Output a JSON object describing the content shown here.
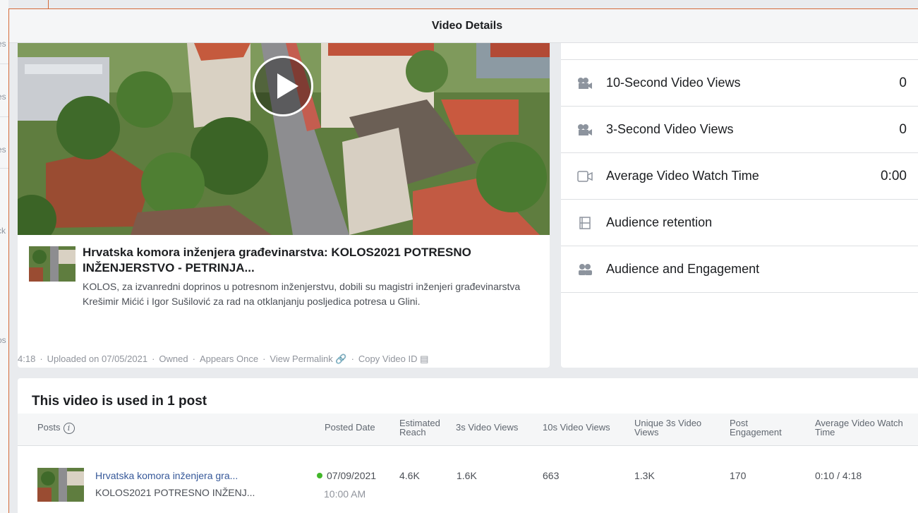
{
  "modal": {
    "title": "Video Details"
  },
  "background_fragments": [
    "es",
    "es",
    "es",
    "ck",
    "os"
  ],
  "video": {
    "title": "Hrvatska komora inženjera građevinarstva: KOLOS2021 POTRESNO INŽENJERSTVO - PETRINJA...",
    "description": "KOLOS, za izvanredni doprinos u potresnom inženjerstvu, dobili su magistri inženjeri građevinarstva Krešimir Mićić i Igor Sušilović za rad na otklanjanju posljedica potresa u Glini.",
    "duration": "4:18",
    "uploaded": "Uploaded on 07/05/2021",
    "ownership": "Owned",
    "appears": "Appears Once",
    "view_permalink": "View Permalink",
    "copy_id": "Copy Video ID"
  },
  "metrics": [
    {
      "label": "10-Second Video Views",
      "value": "0",
      "icon": "video-camera-icon"
    },
    {
      "label": "3-Second Video Views",
      "value": "0",
      "icon": "video-camera-icon"
    },
    {
      "label": "Average Video Watch Time",
      "value": "0:00",
      "icon": "video-outline-icon"
    },
    {
      "label": "Audience retention",
      "value": "",
      "icon": "film-icon"
    },
    {
      "label": "Audience and Engagement",
      "value": "",
      "icon": "people-icon"
    }
  ],
  "posts": {
    "heading": "This video is used in 1 post",
    "columns": {
      "posts": "Posts",
      "posted_date": "Posted Date",
      "reach_1": "Estimated",
      "reach_2": "Reach",
      "views3": "3s Video Views",
      "views10": "10s Video Views",
      "unique_1": "Unique 3s Video",
      "unique_2": "Views",
      "engagement_1": "Post",
      "engagement_2": "Engagement",
      "avg_1": "Average Video Watch",
      "avg_2": "Time"
    },
    "rows": [
      {
        "title": "Hrvatska komora inženjera gra...",
        "subtitle": "KOLOS2021 POTRESNO INŽENJ...",
        "date": "07/09/2021",
        "time": "10:00 AM",
        "reach": "4.6K",
        "views3": "1.6K",
        "views10": "663",
        "unique3": "1.3K",
        "engagement": "170",
        "avg_watch": "0:10 / 4:18"
      }
    ]
  },
  "colors": {
    "accent": "#d46a3a",
    "link": "#365899",
    "status": "#42b72a"
  }
}
